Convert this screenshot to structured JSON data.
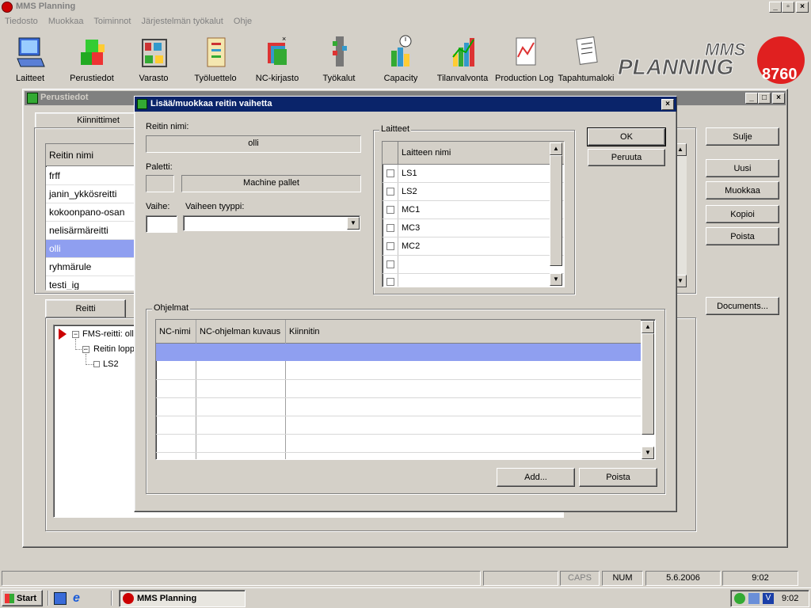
{
  "app": {
    "title": "MMS Planning",
    "menu": [
      "Tiedosto",
      "Muokkaa",
      "Toiminnot",
      "Järjestelmän työkalut",
      "Ohje"
    ],
    "logo_text": "MMS PLANNING",
    "logo_badge": "8760"
  },
  "toolbar": {
    "items": [
      {
        "label": "Laitteet",
        "icon": "computer-icon"
      },
      {
        "label": "Perustiedot",
        "icon": "blocks-icon"
      },
      {
        "label": "Varasto",
        "icon": "storage-shelf-icon"
      },
      {
        "label": "Työluettelo",
        "icon": "clipboard-icon"
      },
      {
        "label": "NC-kirjasto",
        "icon": "nc-library-icon"
      },
      {
        "label": "Työkalut",
        "icon": "tools-icon"
      },
      {
        "label": "Capacity",
        "icon": "capacity-chart-icon"
      },
      {
        "label": "Tilanvalvonta",
        "icon": "status-chart-icon"
      },
      {
        "label": "Production Log",
        "icon": "production-log-icon"
      },
      {
        "label": "Tapahtumaloki",
        "icon": "event-log-icon"
      }
    ]
  },
  "perustiedot": {
    "title": "Perustiedot",
    "tab_top": "Kiinnittimet",
    "list_header": "Reitin nimi",
    "routes": [
      "frff",
      "janin_ykkösreitti",
      "kokoonpano-osan",
      "nelisärmäreitti",
      "olli",
      "ryhmärule",
      "testi_ig"
    ],
    "selected_route": "olli",
    "tab_bottom": "Reitti",
    "tree": {
      "root": "FMS-reitti: olli",
      "child": "Reitin lopp",
      "leaf": "LS2"
    },
    "buttons": {
      "close": "Sulje",
      "new": "Uusi",
      "edit": "Muokkaa",
      "copy": "Kopioi",
      "delete": "Poista",
      "documents": "Documents..."
    }
  },
  "dialog": {
    "title": "Lisää/muokkaa reitin vaihetta",
    "route_name_label": "Reitin nimi:",
    "route_name_value": "olli",
    "pallet_label": "Paletti:",
    "pallet_value": "Machine pallet",
    "phase_label": "Vaihe:",
    "phase_type_label": "Vaiheen tyyppi:",
    "phase_value": "",
    "phase_type_value": "",
    "devices_group": "Laitteet",
    "devices_header": "Laitteen nimi",
    "devices": [
      "LS1",
      "LS2",
      "MC1",
      "MC3",
      "MC2",
      "",
      ""
    ],
    "ok": "OK",
    "cancel": "Peruuta",
    "programs_group": "Ohjelmat",
    "programs_columns": [
      "NC-nimi",
      "NC-ohjelman kuvaus",
      "Kiinnitin"
    ],
    "add": "Add...",
    "delete": "Poista"
  },
  "statusbar": {
    "caps": "CAPS",
    "num": "NUM",
    "date": "5.6.2006",
    "time": "9:02"
  },
  "taskbar": {
    "start": "Start",
    "task": "MMS Planning",
    "clock": "9:02"
  }
}
